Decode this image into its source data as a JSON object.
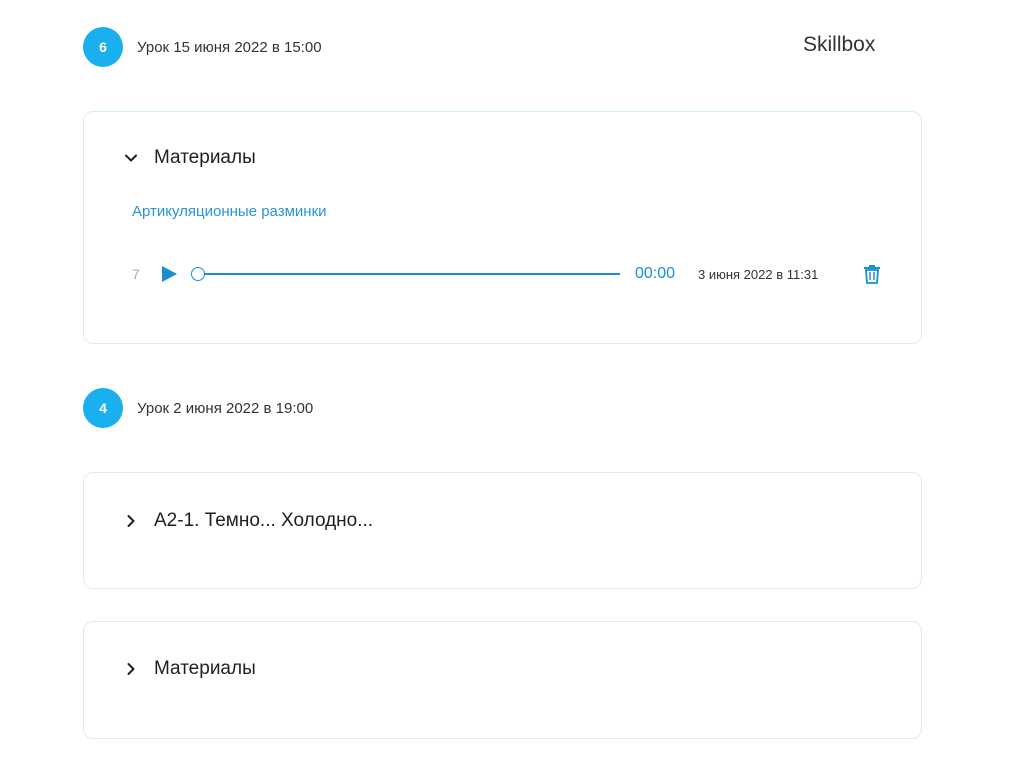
{
  "brand": {
    "name": "Skillbox"
  },
  "lessons": [
    {
      "number": "6",
      "date": "Урок 15 июня 2022 в 15:00",
      "cards": [
        {
          "title": "Материалы",
          "expanded": true,
          "link": "Артикуляционные разминки",
          "audio": {
            "track_number": "7",
            "time": "00:00",
            "uploaded": "3 июня 2022 в 11:31",
            "progress": 0
          }
        }
      ]
    },
    {
      "number": "4",
      "date": "Урок 2 июня 2022 в 19:00",
      "cards": [
        {
          "title": "А2-1. Темно... Холодно...",
          "expanded": false
        },
        {
          "title": "Материалы",
          "expanded": false
        }
      ]
    }
  ],
  "icons": {
    "chevron_expanded": "chevron-down-icon",
    "chevron_collapsed": "chevron-right-icon",
    "play": "play-icon",
    "delete": "trash-icon"
  },
  "colors": {
    "accent": "#1ab0f0",
    "link": "#2896d8",
    "player": "#1a8fd0",
    "card_border": "#d6eef8"
  }
}
